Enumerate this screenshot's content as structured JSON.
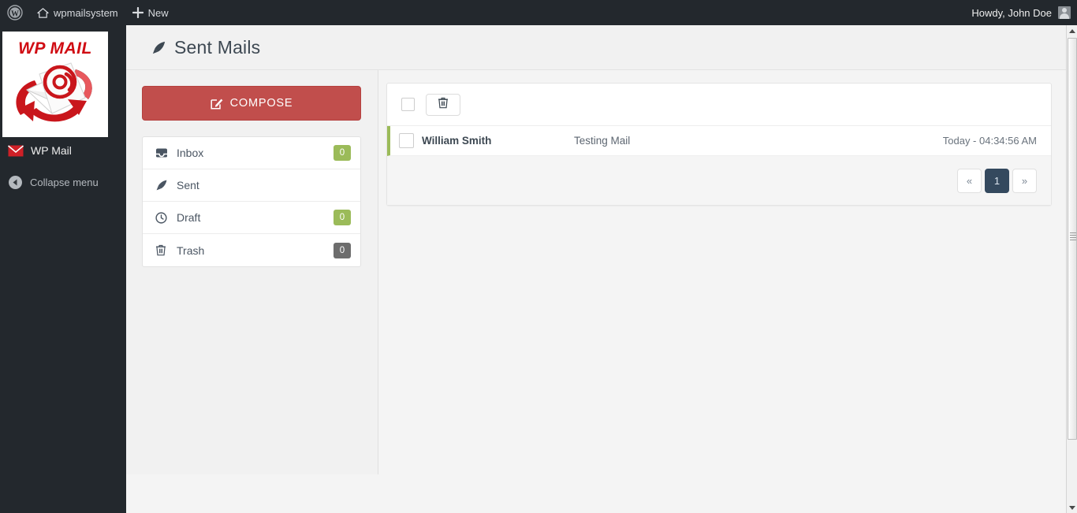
{
  "adminbar": {
    "wp_logo_name": "wordpress-logo-icon",
    "site_name": "wpmailsystem",
    "new_label": "New",
    "howdy": "Howdy, John Doe"
  },
  "wpmenu": {
    "logo_text": "WP MAIL",
    "items": [
      {
        "label": "WP Mail",
        "icon": "envelope-icon"
      },
      {
        "label": "Collapse menu",
        "icon": "collapse-arrow-icon"
      }
    ]
  },
  "page": {
    "title": "Sent Mails",
    "title_icon": "rocket-icon"
  },
  "left_panel": {
    "compose_label": "COMPOSE",
    "compose_icon": "pencil-square-icon",
    "compose_color": "#c14e4c",
    "nav": [
      {
        "label": "Inbox",
        "icon": "inbox-icon",
        "badge": "0",
        "badge_style": "green"
      },
      {
        "label": "Sent",
        "icon": "rocket-icon",
        "badge": null,
        "badge_style": null
      },
      {
        "label": "Draft",
        "icon": "clock-icon",
        "badge": "0",
        "badge_style": "green"
      },
      {
        "label": "Trash",
        "icon": "trash-icon",
        "badge": "0",
        "badge_style": "grey"
      }
    ],
    "badge_green": "#9bbb59",
    "badge_grey": "#6d6d6d"
  },
  "mail_list": {
    "toolbar": {
      "select_all_name": "select-all-checkbox",
      "delete_icon": "trash-icon"
    },
    "rows": [
      {
        "from": "William Smith",
        "subject": "Testing Mail",
        "time": "Today - 04:34:56 AM",
        "accent": "#9bbb59"
      }
    ],
    "pagination": {
      "prev": "«",
      "next": "»",
      "pages": [
        "1"
      ],
      "active": "1",
      "active_color": "#34495e"
    }
  }
}
